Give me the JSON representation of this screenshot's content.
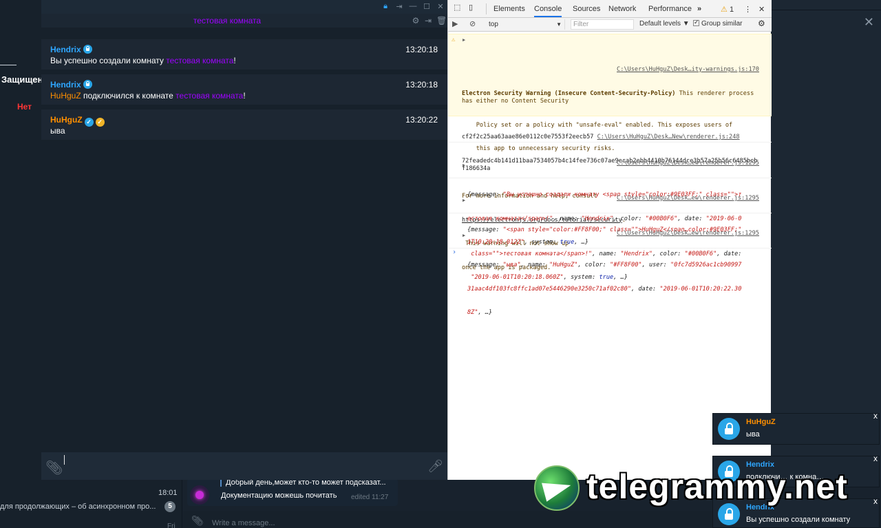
{
  "background": {
    "left_panel": {
      "title": "Защищен",
      "value": "Нет"
    },
    "dialog": {
      "time": "18:01",
      "preview": "для продолжающих – об асинхронном про...",
      "unread": "5",
      "day": "Fri"
    },
    "message": {
      "quote": "Добрый день,может кто-то может подсказат...",
      "text": "Документацию можешь почитать",
      "edited": "edited 11:27"
    },
    "input_placeholder": "Write a message..."
  },
  "app": {
    "room_title": "тестовая комната",
    "messages": [
      {
        "author": "Hendrix",
        "author_color": "#2ea6ff",
        "text_prefix": "Вы успешно создали комнату ",
        "room": "тестовая комната",
        "text_suffix": "!",
        "time": "13:20:18"
      },
      {
        "author": "Hendrix",
        "author_color": "#2ea6ff",
        "user": "HuHguZ",
        "text_middle": " подключился к комнате ",
        "room": "тестовая комната",
        "text_suffix": "!",
        "time": "13:20:18"
      },
      {
        "author": "HuHguZ",
        "author_color": "#ff8f00",
        "text": "ыва",
        "time": "13:20:22"
      }
    ]
  },
  "devtools": {
    "tabs": [
      "Elements",
      "Console",
      "Sources",
      "Network",
      "Performance"
    ],
    "active_tab": "Console",
    "more": "»",
    "warnings_count": "1",
    "context": "top",
    "filter_placeholder": "Filter",
    "levels": "Default levels ▼",
    "group_similar": "Group similar",
    "entries": {
      "warning": {
        "source": "C:\\Users\\HuHguZ\\Desk…ity-warnings.js:170",
        "title": "Electron Security Warning (Insecure Content-Security-Policy)",
        "line1": " This renderer process has either no Content Security",
        "line2": "    Policy set or a policy with \"unsafe-eval\" enabled. This exposes users of",
        "line3": "    this app to unnecessary security risks.",
        "line4": "For more information and help, consult",
        "link": "https://electronjs.org/docs/tutorial/security",
        "line5": ".",
        "line6": " This warning will not show up",
        "line7": "once the app is packaged."
      },
      "hash": {
        "text": "cf2f2c25aa63aae86e0112c0e7553f2eecb57",
        "source": "C:\\Users\\HuHguZ\\Desk…New\\renderer.js:248",
        "rest": "72feadedc4b141d11baa7534057b4c14fee736c07ae9ecab2ebb4410b76144dce3b57a25b56c6485bcbf186634a"
      },
      "obj1": {
        "source": "C:\\Users\\HuHguZ\\Desk…ew\\renderer.js:1295",
        "l1a": "{message: ",
        "l1s": "\"Вы успешно создали комнату <span style=\"color:#9E03FF;\" class=\"\">т",
        "l2s": "естовая комната</span>!\"",
        "l2a": ", name: ",
        "l2n": "\"Hendrix\"",
        "l2b": ", color: ",
        "l2c": "\"#00B0F6\"",
        "l2d": ", date: ",
        "l2e": "\"2019-06-0",
        "l3e": "1T10:20:18.012Z\"",
        "l3a": ", system: ",
        "l3k": "true",
        "l3b": ", …}"
      },
      "obj2": {
        "source": "C:\\Users\\HuHguZ\\Desk…ew\\renderer.js:1295",
        "l1a": "{message: ",
        "l1s": "\"<span style=\"color:#FF8F00;\" class=\"\">HuHguZ</span…color:#9E03FF;\"",
        "l2s": " class=\"\">тестовая комната</span>!\"",
        "l2a": ", name: ",
        "l2n": "\"Hendrix\"",
        "l2b": ", color: ",
        "l2c": "\"#00B0F6\"",
        "l2d": ", date:",
        "l3e": " \"2019-06-01T10:20:18.060Z\"",
        "l3a": ", system: ",
        "l3k": "true",
        "l3b": ", …}"
      },
      "obj3": {
        "source": "C:\\Users\\HuHguZ\\Desk…ew\\renderer.js:1295",
        "l1a": "{message: ",
        "l1s": "\"ыва\"",
        "l1b": ", name: ",
        "l1n": "\"HuHguZ\"",
        "l1c": ", color: ",
        "l1co": "\"#FF8F00\"",
        "l1d": ", user: ",
        "l1u": "\"0fc7d5926ac1cb90997",
        "l2u": "31aac4df103fc8ffc1ad07e5446290e3250c71af02c80\"",
        "l2a": ", date: ",
        "l2e": "\"2019-06-01T10:20:22.30",
        "l3e": "8Z\"",
        "l3b": ", …}"
      }
    },
    "prompt": "›"
  },
  "notifications": [
    {
      "name": "HuHguZ",
      "color": "#ff8f00",
      "text": "ыва"
    },
    {
      "name": "Hendrix",
      "color": "#2ea6ff",
      "text": "подключи… к комна…"
    },
    {
      "name": "Hendrix",
      "color": "#2ea6ff",
      "text": "Вы успешно создали комнату"
    }
  ],
  "close_glyph": "x",
  "watermark": "telegrammy.net"
}
